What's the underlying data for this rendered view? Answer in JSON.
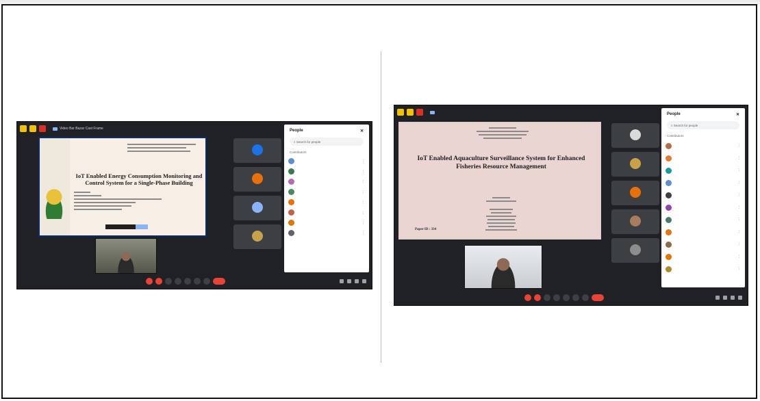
{
  "left_screenshot": {
    "window_title": "Video Bar Bazar Cast Frame",
    "slide": {
      "title": "IoT Enabled Energy Consumption Monitoring and Control System for a Single-Phase Building"
    },
    "tiles": [
      {
        "name": "",
        "avatar_color": "#1a73e8"
      },
      {
        "name": "",
        "avatar_color": "#e8710a"
      },
      {
        "name": "",
        "avatar_color": "#8ab4f8"
      },
      {
        "name": "",
        "avatar_color": "#c8a24a"
      }
    ],
    "people_panel": {
      "title": "People",
      "search_placeholder": "Search for people",
      "subheading": "Contributors",
      "members": [
        {
          "name": "",
          "color": "#5f8fd0"
        },
        {
          "name": "",
          "color": "#3c7a4f"
        },
        {
          "name": "",
          "color": "#b06fae"
        },
        {
          "name": "",
          "color": "#4a8a5a"
        },
        {
          "name": "",
          "color": "#e8710a"
        },
        {
          "name": "",
          "color": "#c0614a"
        },
        {
          "name": "",
          "color": "#e37400"
        },
        {
          "name": "",
          "color": "#5f6368"
        }
      ]
    },
    "bottom_info": ""
  },
  "right_screenshot": {
    "window_title": "",
    "slide": {
      "title": "IoT Enabled Aquaculture Surveillance System for Enhanced Fisheries Resource Management",
      "caption": "Paper ID : 334"
    },
    "tiles": [
      {
        "name": "",
        "avatar_color": "#d9d9d9"
      },
      {
        "name": "",
        "avatar_color": "#c8a24a"
      },
      {
        "name": "",
        "avatar_color": "#e8710a"
      },
      {
        "name": "",
        "avatar_color": "#a77d60"
      },
      {
        "name": "",
        "avatar_color": "#8d8d8d"
      }
    ],
    "people_panel": {
      "title": "People",
      "search_placeholder": "Search for people",
      "subheading": "Contributors",
      "members": [
        {
          "name": "",
          "color": "#b06f4a"
        },
        {
          "name": "",
          "color": "#e07b39"
        },
        {
          "name": "",
          "color": "#1a9aa0"
        },
        {
          "name": "",
          "color": "#5f8fd0"
        },
        {
          "name": "",
          "color": "#3c4043"
        },
        {
          "name": "",
          "color": "#8e44ad"
        },
        {
          "name": "",
          "color": "#4a7a6a"
        },
        {
          "name": "",
          "color": "#e8710a"
        },
        {
          "name": "",
          "color": "#8a6a4a"
        },
        {
          "name": "",
          "color": "#e37400"
        },
        {
          "name": "",
          "color": "#b28a2a"
        }
      ]
    },
    "bottom_info": ""
  },
  "colors": {
    "meet_bg": "#202124",
    "accent_yellow": "#f2c200",
    "end_call_red": "#ea4335"
  }
}
